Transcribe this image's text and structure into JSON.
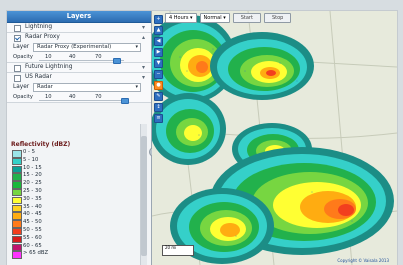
{
  "layers_panel": {
    "title": "Layers",
    "layers": [
      {
        "label": "Lightning",
        "checked": false
      },
      {
        "label": "Radar Proxy",
        "checked": true,
        "layer_label": "Layer",
        "layer_value": "Radar Proxy (Experimental)",
        "opacity_label": "Opacity",
        "opacity_ticks": [
          "10",
          "40",
          "70"
        ],
        "opacity_value": 0.9
      },
      {
        "label": "Future Lightning",
        "checked": false
      },
      {
        "label": "US Radar",
        "checked": false,
        "layer_label": "Layer",
        "layer_value": "Radar",
        "opacity_label": "Opacity",
        "opacity_ticks": [
          "10",
          "40",
          "70"
        ],
        "opacity_value": 1.0
      }
    ],
    "legend_title": "Reflectivity (dBZ)",
    "legend_items": [
      {
        "label": "0 - 5",
        "color": "#9be5e8"
      },
      {
        "label": "5 - 10",
        "color": "#35d0c9"
      },
      {
        "label": "10 - 15",
        "color": "#0d9f95"
      },
      {
        "label": "15 - 20",
        "color": "#22b14c"
      },
      {
        "label": "20 - 25",
        "color": "#1ab83a"
      },
      {
        "label": "25 - 30",
        "color": "#77d641"
      },
      {
        "label": "30 - 35",
        "color": "#ffff33"
      },
      {
        "label": "35 - 40",
        "color": "#ffd21f"
      },
      {
        "label": "40 - 45",
        "color": "#ffac11"
      },
      {
        "label": "45 - 50",
        "color": "#ff7a1a"
      },
      {
        "label": "50 - 55",
        "color": "#f23f1e"
      },
      {
        "label": "55 - 60",
        "color": "#d71c1c"
      },
      {
        "label": "60 - 65",
        "color": "#c0126e"
      },
      {
        "label": "> 65 dBZ",
        "color": "#ff33ff"
      }
    ]
  },
  "map": {
    "time_window": "4 Hours",
    "speed": "Normal",
    "start_label": "Start",
    "stop_label": "Stop",
    "copyright": "Copyright © Vaisala 2013",
    "scale_label": "20 mi"
  },
  "icons": {
    "zoom_in": "plus-icon",
    "zoom_out": "minus-icon",
    "pan_up": "arrow-up-icon",
    "pan_down": "arrow-down-icon",
    "pan_left": "arrow-left-icon",
    "pan_right": "arrow-right-icon",
    "street_view": "pegman-icon",
    "draw": "pencil-icon",
    "measure": "ruler-icon",
    "collapse_panel": "chevron-left-icon"
  }
}
